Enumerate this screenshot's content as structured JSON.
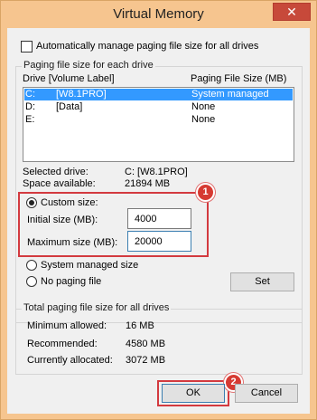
{
  "window": {
    "title": "Virtual Memory",
    "close_glyph": "✕"
  },
  "auto_manage": {
    "label": "Automatically manage paging file size for all drives",
    "checked": false
  },
  "drive_group": {
    "title": "Paging file size for each drive",
    "col_drive": "Drive  [Volume Label]",
    "col_size": "Paging File Size (MB)",
    "drives": [
      {
        "drive": "C:",
        "label": "[W8.1PRO]",
        "size": "System managed",
        "selected": true
      },
      {
        "drive": "D:",
        "label": "[Data]",
        "size": "None",
        "selected": false
      },
      {
        "drive": "E:",
        "label": "",
        "size": "None",
        "selected": false
      }
    ],
    "selected_drive_label": "Selected drive:",
    "selected_drive_value": "C:  [W8.1PRO]",
    "space_label": "Space available:",
    "space_value": "21894 MB",
    "custom_size_label": "Custom size:",
    "initial_label": "Initial size (MB):",
    "initial_value": "4000",
    "maximum_label": "Maximum size (MB):",
    "maximum_value": "20000",
    "system_managed_label": "System managed size",
    "no_paging_label": "No paging file",
    "set_label": "Set",
    "selected_option": "custom"
  },
  "total_group": {
    "title": "Total paging file size for all drives",
    "min_label": "Minimum allowed:",
    "min_value": "16 MB",
    "rec_label": "Recommended:",
    "rec_value": "4580 MB",
    "cur_label": "Currently allocated:",
    "cur_value": "3072 MB"
  },
  "buttons": {
    "ok": "OK",
    "cancel": "Cancel"
  },
  "markers": {
    "one": "1",
    "two": "2"
  },
  "colors": {
    "accent_red": "#d33a3f",
    "selection_blue": "#3399ff",
    "frame": "#f6c58f"
  }
}
